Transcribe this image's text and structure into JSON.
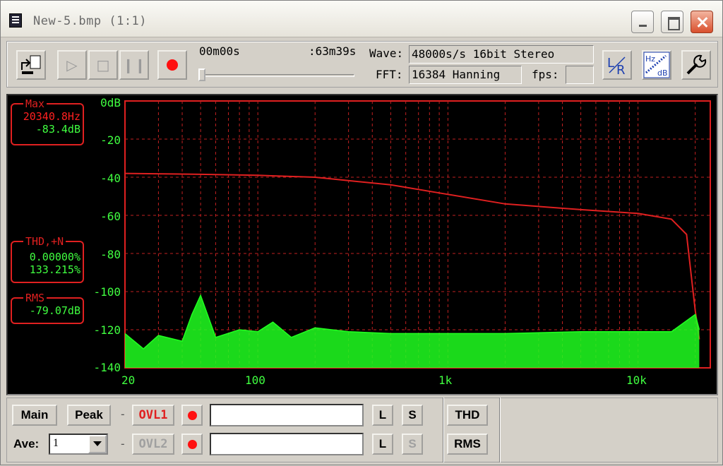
{
  "window": {
    "title": "New-5.bmp (1:1)"
  },
  "toolbar": {
    "time_start": "00m00s",
    "time_end": ":63m39s",
    "slider_position": 0.0,
    "wave_label": "Wave:",
    "wave_value": "48000s/s 16bit Stereo",
    "fft_label": "FFT:",
    "fft_value": "16384 Hanning",
    "fps_label": "fps:",
    "fps_value": "",
    "lr_label": "L R",
    "hz_label": "Hz",
    "db_label": "dB"
  },
  "readouts": {
    "max_title": "Max",
    "max_freq": "20340.8Hz",
    "max_db": "-83.4dB",
    "thd_title": "THD,+N",
    "thd_value": "0.00000%",
    "thdn_value": "133.215%",
    "rms_title": "RMS",
    "rms_value": "-79.07dB"
  },
  "graph": {
    "y_ticks": [
      "0dB",
      "-20",
      "-40",
      "-60",
      "-80",
      "-100",
      "-120",
      "-140"
    ],
    "x_ticks": [
      "20",
      "100",
      "1k",
      "10k"
    ],
    "colors": {
      "grid": "#c02020",
      "frame": "#e02020",
      "ch1": "#e02020",
      "ch2": "#20ff20",
      "labels": "#40ff40"
    }
  },
  "chart_data": {
    "type": "line",
    "x_scale": "log",
    "xlim": [
      20,
      24000
    ],
    "ylim": [
      -140,
      0
    ],
    "series": [
      {
        "x": [
          20,
          50,
          100,
          200,
          500,
          1000,
          2000,
          5000,
          10000,
          15000,
          18000,
          20000,
          21000
        ],
        "y": [
          -38,
          -38.5,
          -39,
          -40,
          -44,
          -49,
          -54,
          -57,
          -59,
          -62,
          -70,
          -110,
          -125
        ]
      },
      {
        "x": [
          20,
          25,
          30,
          40,
          45,
          50,
          60,
          80,
          100,
          120,
          150,
          200,
          300,
          500,
          1000,
          2000,
          5000,
          10000,
          15000,
          20000,
          21000
        ],
        "y": [
          -122,
          -130,
          -123,
          -126,
          -112,
          -102,
          -124,
          -120,
          -121,
          -116,
          -124,
          -119,
          -121,
          -122,
          -122,
          -122,
          -121,
          -121,
          -121,
          -112,
          -120
        ]
      }
    ]
  },
  "bottom": {
    "main_label": "Main",
    "peak_label": "Peak",
    "ovl1_label": "OVL1",
    "ovl2_label": "OVL2",
    "ave_label": "Ave:",
    "ave_value": "1",
    "l_label": "L",
    "s_label": "S",
    "thd_label": "THD",
    "rms_label": "RMS",
    "dash": "-"
  }
}
